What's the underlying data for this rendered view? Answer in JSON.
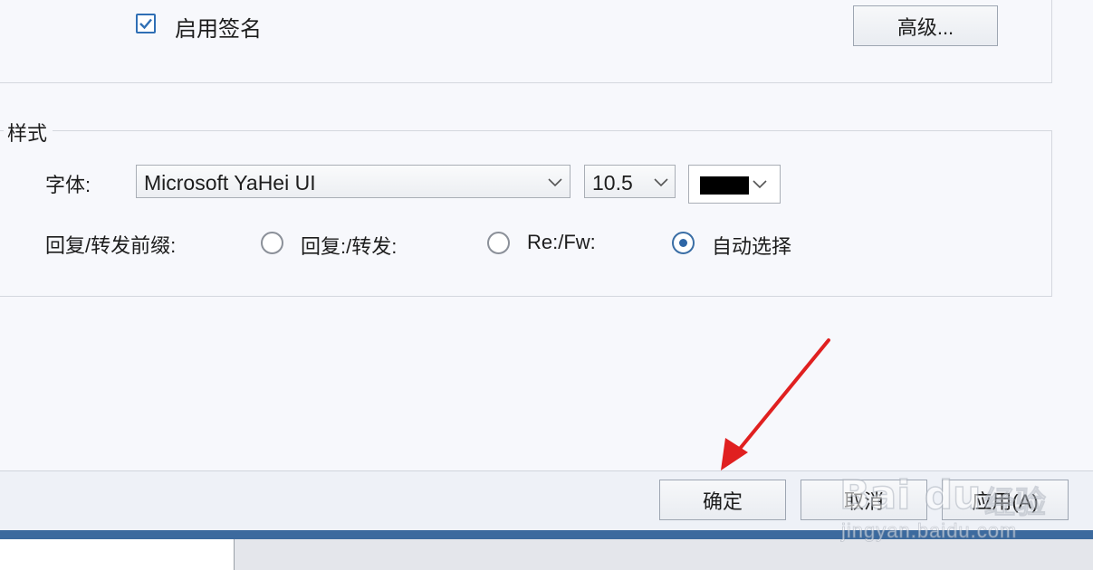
{
  "signature": {
    "enable_signature_label": "启用签名",
    "enable_signature_checked": true,
    "advanced_button_label": "高级..."
  },
  "style_group": {
    "title": "样式",
    "font_label": "字体:",
    "font_value": "Microsoft YaHei UI",
    "size_value": "10.5",
    "color_value": "#000000",
    "prefix_label": "回复/转发前缀:",
    "prefix_options": [
      {
        "label": "回复:/转发:",
        "selected": false
      },
      {
        "label": "Re:/Fw:",
        "selected": false
      },
      {
        "label": "自动选择",
        "selected": true
      }
    ]
  },
  "footer": {
    "ok_label": "确定",
    "cancel_label": "取消",
    "apply_label": "应用(A)"
  },
  "annotation": {
    "arrow_color": "#e02020"
  },
  "watermark": {
    "logo_text": "Bai du",
    "brand_text": "经验",
    "url_text": "jingyan.baidu.com"
  },
  "colors": {
    "accent": "#2f6fb5",
    "window_frame": "#3c6a9e"
  },
  "icons": {
    "check": "check-icon",
    "dropdown": "chevron-down-icon"
  }
}
